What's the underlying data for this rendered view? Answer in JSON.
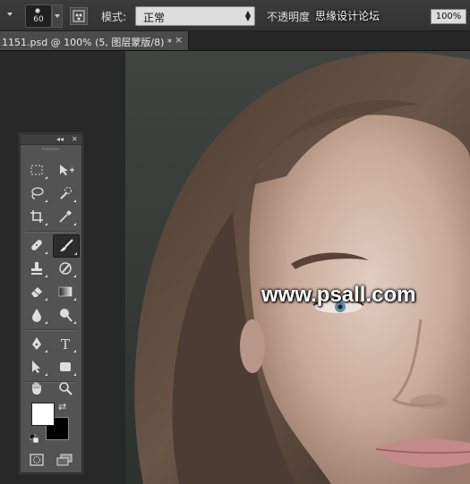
{
  "options_bar": {
    "brush_size": "60",
    "mode_label": "模式:",
    "mode_value": "正常",
    "opacity_label": "不透明度",
    "opacity_value": "100%",
    "overlay_text": "思缘设计论坛"
  },
  "document_tab": {
    "title": "1151.psd @ 100% (5, 图层蒙版/8) *",
    "close_glyph": "×"
  },
  "toolbox": {
    "collapse_glyph": "◂◂",
    "close_glyph": "✕",
    "tools": [
      {
        "name": "rectangular-marquee-icon",
        "active": false
      },
      {
        "name": "move-icon",
        "active": false
      },
      {
        "name": "lasso-icon",
        "active": false
      },
      {
        "name": "quick-selection-icon",
        "active": false
      },
      {
        "name": "crop-icon",
        "active": false
      },
      {
        "name": "eyedropper-icon",
        "active": false
      },
      {
        "name": "healing-brush-icon",
        "active": false
      },
      {
        "name": "brush-icon",
        "active": true
      },
      {
        "name": "clone-stamp-icon",
        "active": false
      },
      {
        "name": "history-brush-icon",
        "active": false
      },
      {
        "name": "eraser-icon",
        "active": false
      },
      {
        "name": "gradient-icon",
        "active": false
      },
      {
        "name": "blur-icon",
        "active": false
      },
      {
        "name": "dodge-icon",
        "active": false
      },
      {
        "name": "pen-icon",
        "active": false
      },
      {
        "name": "type-icon",
        "active": false
      },
      {
        "name": "path-selection-icon",
        "active": false
      },
      {
        "name": "rectangle-shape-icon",
        "active": false
      },
      {
        "name": "hand-icon",
        "active": false
      },
      {
        "name": "zoom-icon",
        "active": false
      }
    ],
    "type_glyph": "T",
    "swap_glyph": "⇄",
    "foreground_color": "#ffffff",
    "background_color": "#000000"
  },
  "canvas": {
    "watermark": "www.psall.com"
  },
  "colors": {
    "ui_dark": "#282828",
    "panel": "#535353",
    "options_bar": "#383838"
  }
}
